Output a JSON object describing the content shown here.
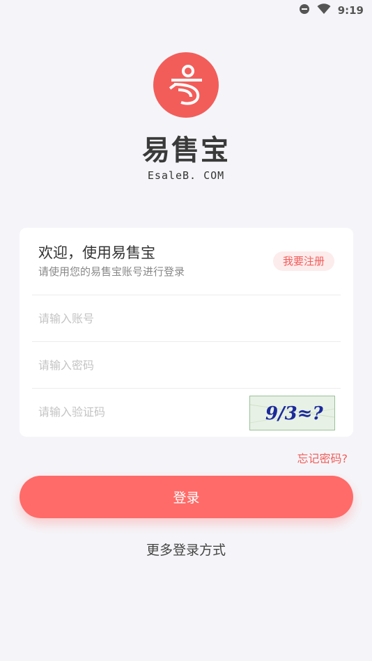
{
  "status_bar": {
    "time": "9:19",
    "icons": [
      "do-not-disturb-icon",
      "wifi-icon"
    ]
  },
  "brand": {
    "name_cn": "易售宝",
    "name_en": "EsaleB. COM",
    "logo_color": "#f25d5a"
  },
  "login_card": {
    "welcome": "欢迎，使用易售宝",
    "subtitle": "请使用您的易售宝账号进行登录",
    "register_label": "我要注册",
    "account_placeholder": "请输入账号",
    "password_placeholder": "请输入密码",
    "captcha_placeholder": "请输入验证码",
    "captcha_text": "9/3≈?"
  },
  "forgot_password": "忘记密码?",
  "login_button": "登录",
  "more_login": "更多登录方式",
  "colors": {
    "accent": "#f25d5a",
    "button": "#ff6b68",
    "background": "#f5f5f9"
  }
}
